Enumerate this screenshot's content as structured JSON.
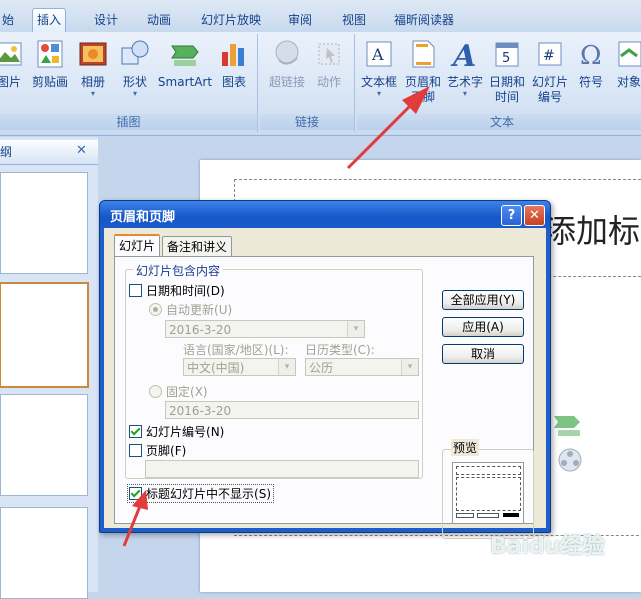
{
  "ribbon_tabs": {
    "t0": "始",
    "t1": "插入",
    "t2": "设计",
    "t3": "动画",
    "t4": "幻灯片放映",
    "t5": "审阅",
    "t6": "视图",
    "t7": "福昕阅读器"
  },
  "ribbon": {
    "picture": "图片",
    "clipart": "剪贴画",
    "album": "相册",
    "shapes": "形状",
    "smartart": "SmartArt",
    "chart": "图表",
    "hyperlink": "超链接",
    "action": "动作",
    "textbox": "文本框",
    "header_footer_1": "页眉和",
    "header_footer_2": "页脚",
    "wordart": "艺术字",
    "datetime_1": "日期和",
    "datetime_2": "时间",
    "slidenum_1": "幻灯片",
    "slidenum_2": "编号",
    "symbol": "符号",
    "object": "对象",
    "group_illustrations": "插图",
    "group_links": "链接",
    "group_text": "文本",
    "dropdown_glyph": "▾"
  },
  "outline_pane": {
    "tab_label": "纲",
    "close_glyph": "✕"
  },
  "slide": {
    "title_fragment": "添加标"
  },
  "dialog": {
    "title": "页眉和页脚",
    "help_glyph": "?",
    "close_glyph": "✕",
    "tabs": {
      "slide": "幻灯片",
      "notes": "备注和讲义"
    },
    "group_legend": "幻灯片包含内容",
    "date_time": {
      "label": "日期和时间",
      "hotkey": "(D)",
      "checked": false
    },
    "auto_update": {
      "label": "自动更新",
      "hotkey": "(U)",
      "selected": true
    },
    "auto_date_value": "2016-3-20",
    "language_label": "语言(国家/地区)(L):",
    "language_value": "中文(中国)",
    "calendar_label": "日历类型(C):",
    "calendar_value": "公历",
    "fixed": {
      "label": "固定",
      "hotkey": "(X)",
      "selected": false
    },
    "fixed_value": "2016-3-20",
    "slide_number": {
      "label": "幻灯片编号",
      "hotkey": "(N)",
      "checked": true
    },
    "footer": {
      "label": "页脚",
      "hotkey": "(F)",
      "checked": false
    },
    "footer_value": "",
    "dont_show_title": {
      "label": "标题幻灯片中不显示",
      "hotkey": "(S)",
      "checked": true
    },
    "buttons": {
      "apply_all": "全部应用(Y)",
      "apply": "应用(A)",
      "cancel": "取消"
    },
    "preview_label": "预览",
    "combo_arrow": "▾"
  },
  "watermark": {
    "brand": "Baidu经验",
    "url": "jingyan.baidu.com"
  },
  "colors": {
    "annotation_arrow": "#e23b3b",
    "accent_tab": "#e68b2c"
  }
}
